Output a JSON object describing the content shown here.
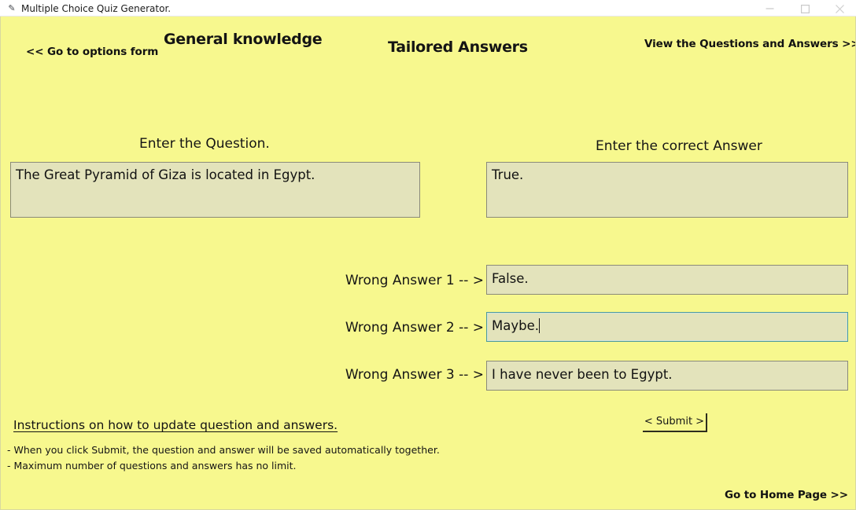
{
  "window": {
    "title": "Multiple Choice Quiz Generator.",
    "app_icon": "quiz-app-icon",
    "controls": {
      "minimize": "minimize-icon",
      "maximize": "maximize-icon",
      "close": "close-icon"
    },
    "background_color": "#f7f88e"
  },
  "header": {
    "options_form_link": "<< Go to options form",
    "category_title": "General knowledge",
    "mode_title": "Tailored Answers",
    "view_qa_link": "View the Questions and Answers >>"
  },
  "question": {
    "label": "Enter the Question.",
    "value": "The Great Pyramid of Giza is located in Egypt.",
    "placeholder": ""
  },
  "correct_answer": {
    "label": "Enter the correct Answer",
    "value": "True.",
    "placeholder": ""
  },
  "wrong_answers": [
    {
      "label": "Wrong Answer 1 -- >",
      "value": "False.",
      "focused": false
    },
    {
      "label": "Wrong Answer 2 -- >",
      "value": "Maybe.",
      "focused": true
    },
    {
      "label": "Wrong Answer 3 -- >",
      "value": "I have never been to Egypt.",
      "focused": false
    }
  ],
  "instructions": {
    "heading": "Instructions on how to update question and answers.",
    "lines": [
      "- When you click Submit, the question and answer will be saved automatically together.",
      "- Maximum number of questions and answers has no limit."
    ]
  },
  "submit": {
    "label": "< Submit >"
  },
  "footer": {
    "home_link": "Go to Home Page >>"
  },
  "colors": {
    "form_background": "#f7f88e",
    "textbox_background": "#e3e3bb",
    "textbox_border": "#8a8a7a",
    "focused_border": "#4f9a9a",
    "text": "#111111"
  }
}
